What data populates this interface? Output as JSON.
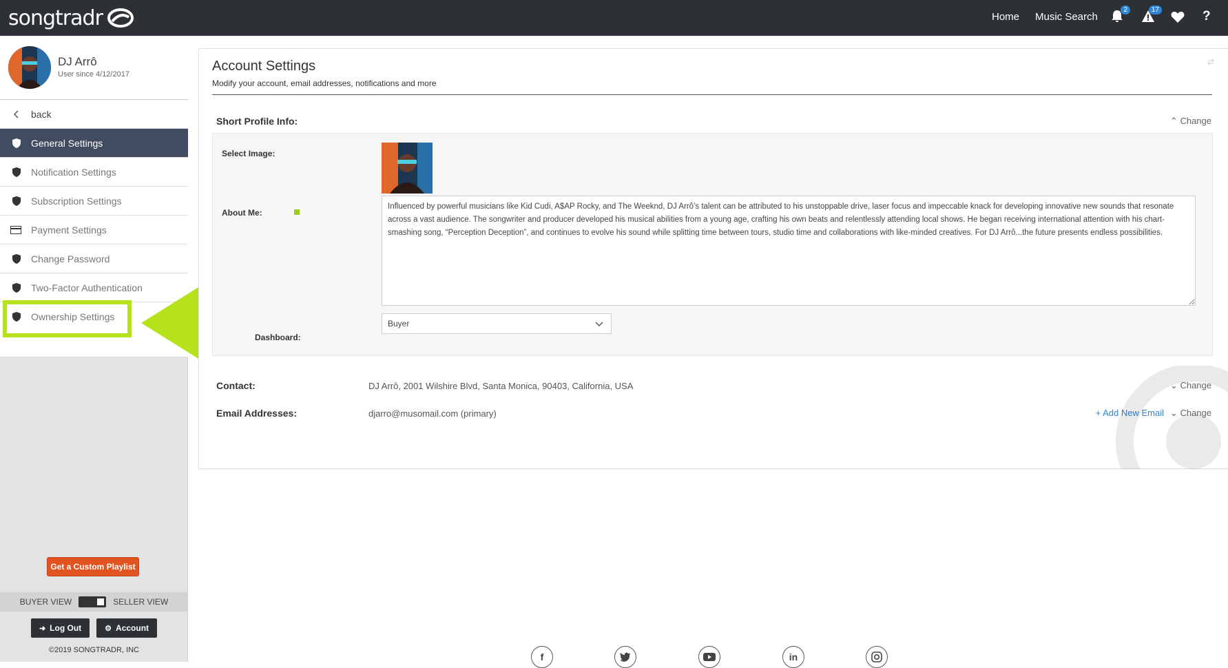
{
  "header": {
    "logo_text": "songtradr",
    "nav": {
      "home": "Home",
      "music_search": "Music Search"
    },
    "notifications_count": "2",
    "alerts_count": "17",
    "help_label": "?"
  },
  "sidebar": {
    "profile": {
      "name": "DJ Arrô",
      "since": "User since 4/12/2017"
    },
    "back_label": "back",
    "items": [
      {
        "label": "General Settings",
        "icon": "shield-icon",
        "active": true
      },
      {
        "label": "Notification Settings",
        "icon": "shield-icon"
      },
      {
        "label": "Subscription Settings",
        "icon": "shield-icon"
      },
      {
        "label": "Payment Settings",
        "icon": "credit-card-icon"
      },
      {
        "label": "Change Password",
        "icon": "shield-icon"
      },
      {
        "label": "Two-Factor Authentication",
        "icon": "shield-icon"
      },
      {
        "label": "Ownership Settings",
        "icon": "shield-icon"
      }
    ],
    "cta_label": "Get a Custom Playlist",
    "buyer_view": "BUYER VIEW",
    "seller_view": "SELLER VIEW",
    "logout_label": "Log Out",
    "account_label": "Account",
    "copyright": "©2019 SONGTRADR, INC"
  },
  "main": {
    "title": "Account Settings",
    "subtitle": "Modify your account, email addresses, notifications and more",
    "short_profile": {
      "label": "Short Profile Info:",
      "change": "Change",
      "select_image_label": "Select Image:",
      "about_me_label": "About Me:",
      "about_me_text": "Influenced by powerful musicians like Kid Cudi, A$AP Rocky, and The Weeknd, DJ Arrô’s talent can be attributed to his unstoppable drive, laser focus and impeccable knack for developing innovative new sounds that resonate across a vast audience. The songwriter and producer developed his musical abilities from a young age, crafting his own beats and relentlessly attending local shows. He began receiving international attention with his chart-smashing song, “Perception Deception”, and continues to evolve his sound while splitting time between tours, studio time and collaborations with like-minded creatives. For DJ Arrô...the future presents endless possibilities.",
      "dashboard_label": "Dashboard:",
      "dashboard_value": "Buyer"
    },
    "contact": {
      "label": "Contact:",
      "value": "DJ Arrô, 2001 Wilshire Blvd, Santa Monica, 90403, California, USA",
      "change": "Change"
    },
    "email": {
      "label": "Email Addresses:",
      "value": "djarro@musomail.com (primary)",
      "add": "+ Add New Email",
      "change": "Change"
    }
  },
  "footer": {
    "social": [
      "f",
      "t",
      "yt",
      "in",
      "ig"
    ]
  },
  "colors": {
    "topbar": "#2d3136",
    "active_menu": "#424c61",
    "highlight": "#b6e21b",
    "cta": "#e2541f",
    "link": "#2f86d2"
  }
}
